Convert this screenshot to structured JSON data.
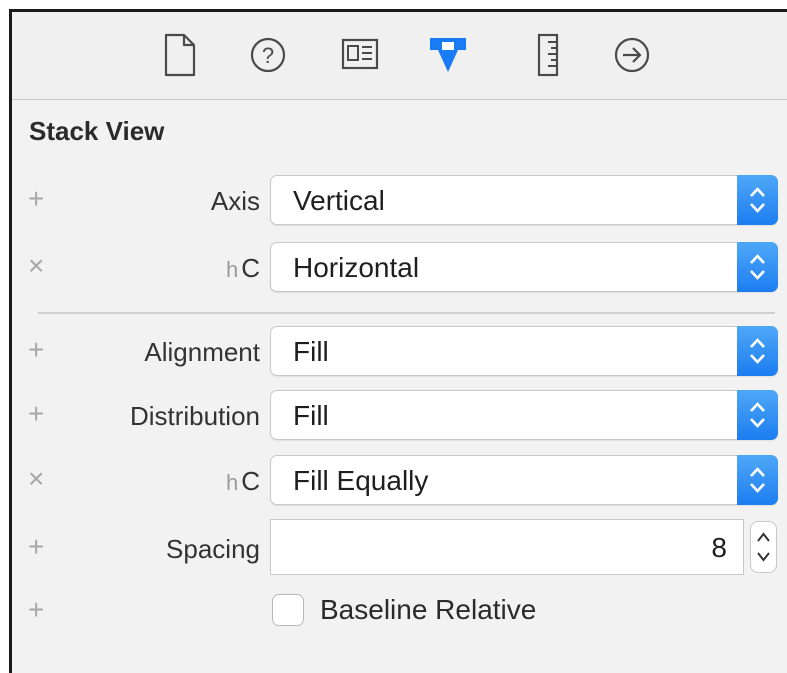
{
  "toolbar": {
    "icons": [
      "file-icon",
      "help-icon",
      "identity-icon",
      "attributes-icon",
      "size-ruler-icon",
      "connections-icon"
    ],
    "active_icon": "attributes-icon",
    "accent_color": "#1a7cf5"
  },
  "section": {
    "title": "Stack View"
  },
  "rows": [
    {
      "modifier": "+",
      "label": "Axis",
      "size_class": "",
      "value": "Vertical"
    },
    {
      "modifier": "×",
      "label": "C",
      "size_class": "h",
      "value": "Horizontal"
    },
    {
      "modifier": "+",
      "label": "Alignment",
      "size_class": "",
      "value": "Fill"
    },
    {
      "modifier": "+",
      "label": "Distribution",
      "size_class": "",
      "value": "Fill"
    },
    {
      "modifier": "×",
      "label": "C",
      "size_class": "h",
      "value": "Fill Equally"
    }
  ],
  "spacing": {
    "modifier": "+",
    "label": "Spacing",
    "value": "8"
  },
  "baseline": {
    "modifier": "+",
    "label": "Baseline Relative",
    "checked": false
  }
}
